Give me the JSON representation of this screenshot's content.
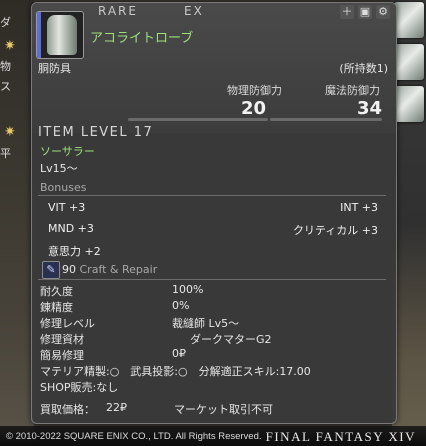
{
  "window": {
    "rarity_label": "RARE",
    "ex_label": "EX"
  },
  "item": {
    "name": "アコライトローブ",
    "slot": "胴防具",
    "owned": "(所持数1)",
    "physical_defense_label": "物理防御力",
    "physical_defense": "20",
    "magic_defense_label": "魔法防御力",
    "magic_defense": "34",
    "item_level": "ITEM LEVEL 17",
    "class_job": "ソーサラー",
    "level_req": "Lv15〜"
  },
  "header_icons": [
    "plus-icon",
    "lock-icon",
    "gear-icon"
  ],
  "bonuses": {
    "title": "Bonuses",
    "vit": "VIT +3",
    "int": "INT +3",
    "mnd": "MND +3",
    "crit": "クリティカル +3",
    "determination": "意思力 +2"
  },
  "craft": {
    "icon": "needle-icon",
    "level": "90",
    "title": "Craft & Repair",
    "rows": [
      {
        "label": "耐久度",
        "value": "100%"
      },
      {
        "label": "錬精度",
        "value": "0%"
      },
      {
        "label": "修理レベル",
        "value": "裁縫師 Lv5〜"
      },
      {
        "label": "修理資材",
        "value": "ダークマターG2"
      },
      {
        "label": "簡易修理",
        "value": "0₽"
      }
    ]
  },
  "footer": {
    "materia_line": "マテリア精製:○　武具投影:○　分解適正スキル:17.00",
    "shop_line": "SHOP販売:なし",
    "price_label": "買取価格：",
    "price_value": "22₽",
    "market": "マーケット取引不可"
  },
  "background": {
    "left_labels": [
      "ダ",
      "物",
      "ス",
      "平"
    ],
    "copyright": "© 2010-2022 SQUARE ENIX CO., LTD. All Rights Reserved.",
    "logo": "FINAL FANTASY XIV"
  },
  "colors": {
    "accent_green": "#9ee07a",
    "accent_blue": "#5d6fd6"
  }
}
